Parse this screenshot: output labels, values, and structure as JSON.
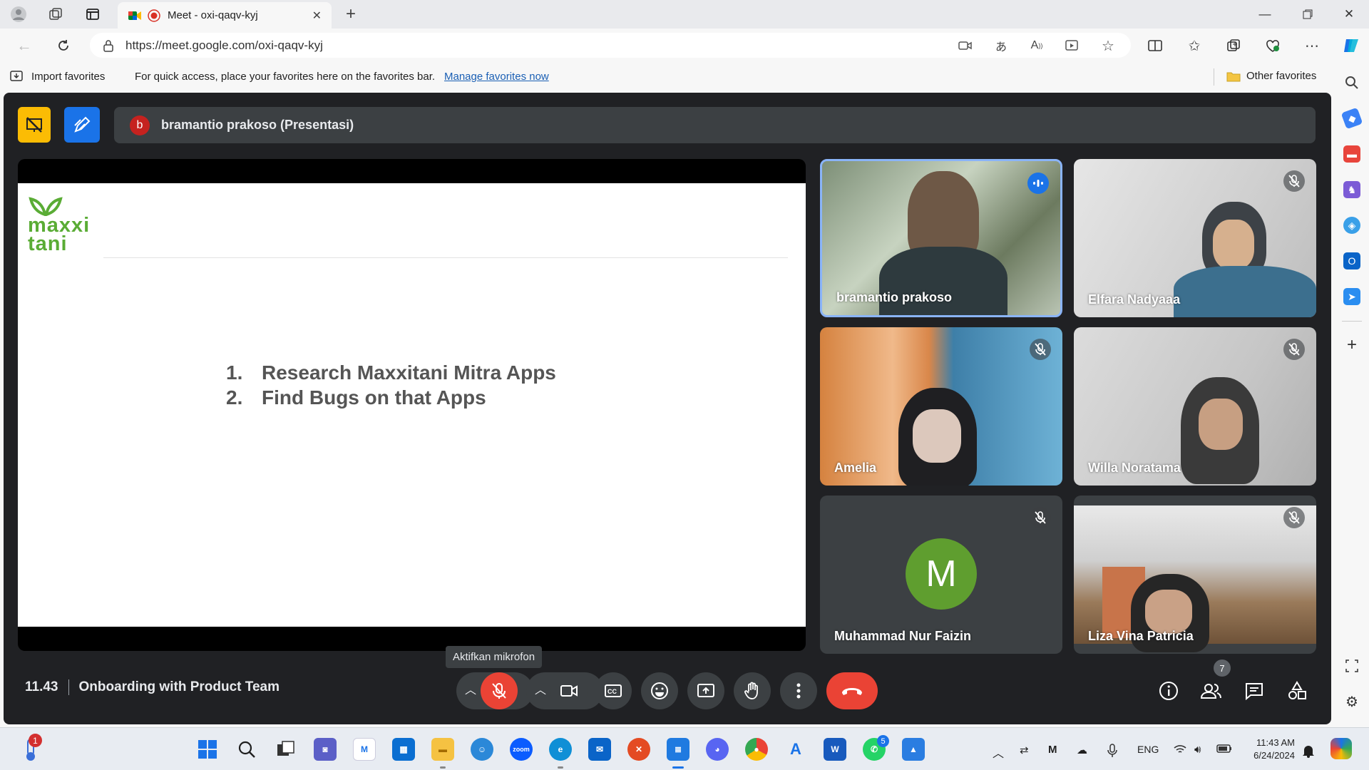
{
  "browser": {
    "tab_title": "Meet - oxi-qaqv-kyj",
    "url": "https://meet.google.com/oxi-qaqv-kyj",
    "favorites_import": "Import favorites",
    "favorites_prompt": "For quick access, place your favorites here on the favorites bar.",
    "favorites_link": "Manage favorites now",
    "other_favorites": "Other favorites"
  },
  "meet": {
    "presenter_initial": "b",
    "presenter_label": "bramantio prakoso (Presentasi)",
    "slide": {
      "logo_line1": "maxxi",
      "logo_line2": "tani",
      "items": [
        {
          "num": "1.",
          "text": "Research Maxxitani Mitra Apps"
        },
        {
          "num": "2.",
          "text": "Find Bugs on that Apps"
        }
      ]
    },
    "participants": [
      {
        "name": "bramantio prakoso",
        "speaking": true,
        "muted": false
      },
      {
        "name": "Elfara Nadyaaa",
        "muted": true
      },
      {
        "name": "Amelia",
        "muted": true
      },
      {
        "name": "Willa Noratama",
        "muted": true
      },
      {
        "name": "Muhammad Nur Faizin",
        "avatar_letter": "M",
        "avatar_color": "#5f9e2f",
        "muted": true
      },
      {
        "name": "Liza Vina Patricia",
        "muted": true
      }
    ],
    "time": "11.43",
    "meeting_title": "Onboarding with Product Team",
    "mic_tooltip": "Aktifkan mikrofon",
    "participant_count": "7",
    "accent_red": "#ea4335",
    "accent_blue": "#8ab4f8"
  },
  "taskbar": {
    "notification_badge": "1",
    "whatsapp_badge": "5",
    "lang": "ENG",
    "clock_time": "11:43 AM",
    "clock_date": "6/24/2024"
  }
}
